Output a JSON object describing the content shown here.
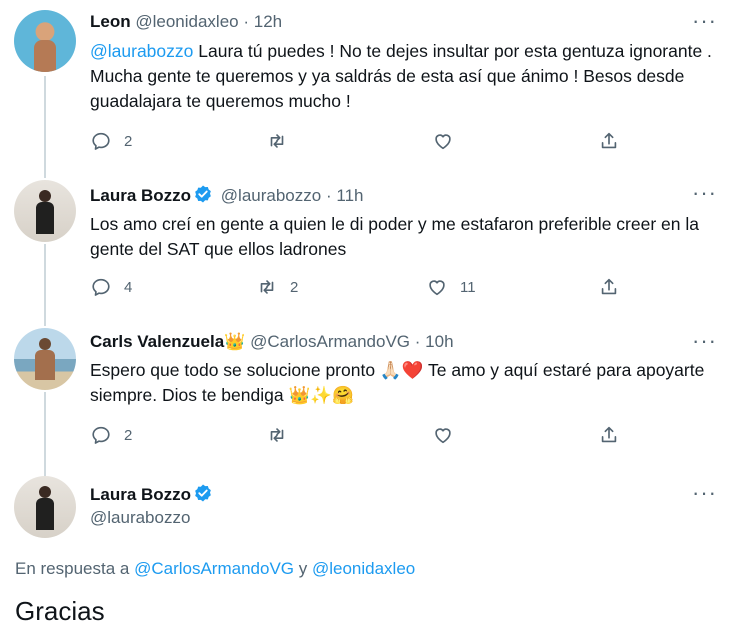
{
  "tweets": [
    {
      "name": "Leon",
      "handle": "@leonidaxleo",
      "dot": "·",
      "time": "12h",
      "text_mention": "@laurabozzo",
      "text": " Laura tú puedes ! No te dejes insultar por esta gentuza ignorante . Mucha gente te queremos y ya saldrás de esta así que ánimo ! Besos desde guadalajara te queremos mucho !",
      "replies": "2",
      "retweets": "",
      "likes": ""
    },
    {
      "name": "Laura Bozzo",
      "handle": "@laurabozzo",
      "dot": "·",
      "time": "11h",
      "text": "Los amo creí en gente a quien le di poder y me estafaron preferible creer en la gente del SAT que ellos ladrones",
      "replies": "4",
      "retweets": "2",
      "likes": "11"
    },
    {
      "name": "Carls Valenzuela",
      "name_emoji": "👑",
      "handle": "@CarlosArmandoVG",
      "dot": "·",
      "time": "10h",
      "text1": "Espero que todo se solucione pronto ",
      "emoji1": "🙏🏻❤️",
      "text2": " Te amo y aquí estaré para apoyarte siempre. Dios te bendiga ",
      "emoji2": "👑✨🤗",
      "replies": "2",
      "retweets": "",
      "likes": ""
    }
  ],
  "main_tweet": {
    "name": "Laura Bozzo",
    "handle": "@laurabozzo",
    "reply_prefix": "En respuesta a ",
    "reply_user1": "@CarlosArmandoVG",
    "reply_join": " y ",
    "reply_user2": "@leonidaxleo",
    "text": "Gracias"
  },
  "icons": {
    "more": "more-icon",
    "reply": "reply-icon",
    "retweet": "retweet-icon",
    "like": "heart-icon",
    "share": "share-icon",
    "verified": "verified-badge-icon"
  },
  "colors": {
    "accent": "#1d9bf0",
    "secondary_text": "#536471",
    "thread_line": "#cfd9de"
  }
}
